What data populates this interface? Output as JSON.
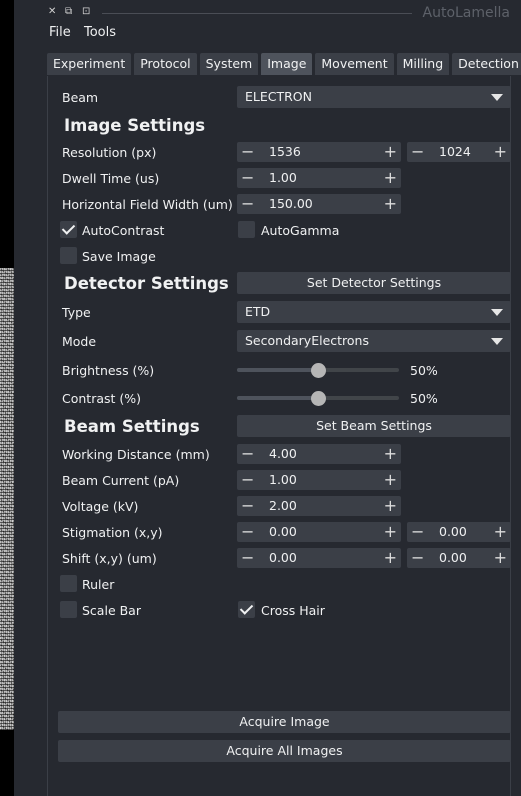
{
  "window": {
    "title": "AutoLamella",
    "buttons": {
      "close": "✕",
      "float": "⧉",
      "restore": "⊡"
    }
  },
  "menu": [
    "File",
    "Tools"
  ],
  "tabs": [
    "Experiment",
    "Protocol",
    "System",
    "Image",
    "Movement",
    "Milling",
    "Detection"
  ],
  "active_tab": "Image",
  "beam": {
    "label": "Beam",
    "value": "ELECTRON"
  },
  "image_settings": {
    "title": "Image Settings",
    "resolution": {
      "label": "Resolution (px)",
      "x": "1536",
      "y": "1024"
    },
    "dwell_time": {
      "label": "Dwell Time (us)",
      "value": "1.00"
    },
    "hfw": {
      "label": "Horizontal Field Width (um)",
      "value": "150.00"
    },
    "autocontrast": {
      "label": "AutoContrast",
      "checked": true
    },
    "autogamma": {
      "label": "AutoGamma",
      "checked": false
    },
    "save_image": {
      "label": "Save Image",
      "checked": false
    }
  },
  "detector_settings": {
    "title": "Detector Settings",
    "button": "Set Detector Settings",
    "type": {
      "label": "Type",
      "value": "ETD"
    },
    "mode": {
      "label": "Mode",
      "value": "SecondaryElectrons"
    },
    "brightness": {
      "label": "Brightness (%)",
      "value": 50,
      "display": "50%"
    },
    "contrast": {
      "label": "Contrast (%)",
      "value": 50,
      "display": "50%"
    }
  },
  "beam_settings": {
    "title": "Beam Settings",
    "button": "Set Beam Settings",
    "working_distance": {
      "label": "Working Distance (mm)",
      "value": "4.00"
    },
    "beam_current": {
      "label": "Beam Current (pA)",
      "value": "1.00"
    },
    "voltage": {
      "label": "Voltage (kV)",
      "value": "2.00"
    },
    "stigmation": {
      "label": "Stigmation (x,y)",
      "x": "0.00",
      "y": "0.00"
    },
    "shift": {
      "label": "Shift (x,y) (um)",
      "x": "0.00",
      "y": "0.00"
    },
    "ruler": {
      "label": "Ruler",
      "checked": false
    },
    "scale_bar": {
      "label": "Scale Bar",
      "checked": false
    },
    "cross_hair": {
      "label": "Cross Hair",
      "checked": true
    }
  },
  "actions": {
    "acquire_image": "Acquire Image",
    "acquire_all": "Acquire All Images"
  },
  "spin_symbols": {
    "minus": "−",
    "plus": "+"
  },
  "handle_symbol": "⋮"
}
